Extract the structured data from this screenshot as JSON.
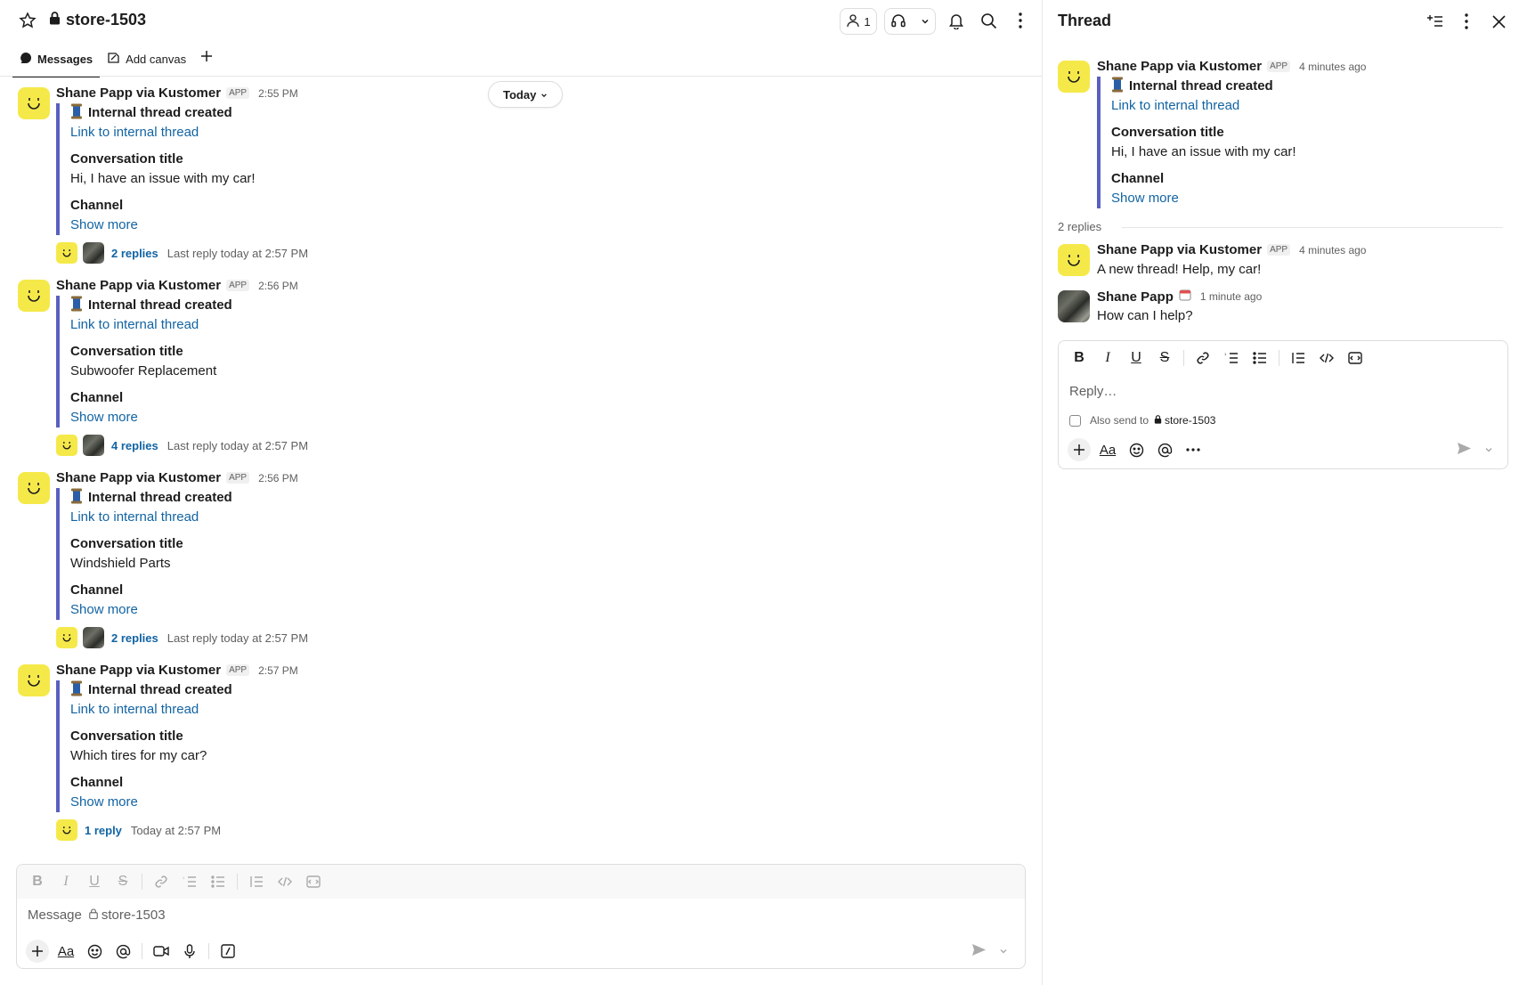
{
  "channel": {
    "name": "store-1503",
    "members_count": "1"
  },
  "tabs": [
    {
      "label": "Messages",
      "active": true
    },
    {
      "label": "Add canvas",
      "active": false
    }
  ],
  "date_divider": "Today",
  "messages": [
    {
      "author": "Shane Papp via Kustomer",
      "badge": "APP",
      "time": "2:55 PM",
      "headline": "Internal thread created",
      "link": "Link to internal thread",
      "conv_label": "Conversation title",
      "conv_value": "Hi, I have an issue with my car!",
      "channel_label": "Channel",
      "show_more": "Show more",
      "replies": "2 replies",
      "last_reply": "Last reply today at 2:57 PM"
    },
    {
      "author": "Shane Papp via Kustomer",
      "badge": "APP",
      "time": "2:56 PM",
      "headline": "Internal thread created",
      "link": "Link to internal thread",
      "conv_label": "Conversation title",
      "conv_value": "Subwoofer Replacement",
      "channel_label": "Channel",
      "show_more": "Show more",
      "replies": "4 replies",
      "last_reply": "Last reply today at 2:57 PM"
    },
    {
      "author": "Shane Papp via Kustomer",
      "badge": "APP",
      "time": "2:56 PM",
      "headline": "Internal thread created",
      "link": "Link to internal thread",
      "conv_label": "Conversation title",
      "conv_value": "Windshield Parts",
      "channel_label": "Channel",
      "show_more": "Show more",
      "replies": "2 replies",
      "last_reply": "Last reply today at 2:57 PM"
    },
    {
      "author": "Shane Papp via Kustomer",
      "badge": "APP",
      "time": "2:57 PM",
      "headline": "Internal thread created",
      "link": "Link to internal thread",
      "conv_label": "Conversation title",
      "conv_value": "Which tires for my car?",
      "channel_label": "Channel",
      "show_more": "Show more",
      "replies": "1 reply",
      "last_reply": "Today at 2:57 PM"
    }
  ],
  "composer": {
    "placeholder": "Message",
    "channel": "store-1503"
  },
  "thread": {
    "title": "Thread",
    "root": {
      "author": "Shane Papp via Kustomer",
      "badge": "APP",
      "time": "4 minutes ago",
      "headline": "Internal thread created",
      "link": "Link to internal thread",
      "conv_label": "Conversation title",
      "conv_value": "Hi, I have an issue with my car!",
      "channel_label": "Channel",
      "show_more": "Show more"
    },
    "reply_count": "2 replies",
    "replies": [
      {
        "author": "Shane Papp via Kustomer",
        "badge": "APP",
        "time": "4 minutes ago",
        "text": "A new thread! Help, my car!"
      },
      {
        "author": "Shane Papp",
        "time": "1 minute ago",
        "text": "How can I help?"
      }
    ],
    "composer": {
      "placeholder": "Reply…",
      "also_send": "Also send to",
      "channel": "store-1503"
    }
  },
  "colors": {
    "accent_bar": "#5a5fbf",
    "link": "#1264a3",
    "avatar_bg": "#f5e94a"
  }
}
